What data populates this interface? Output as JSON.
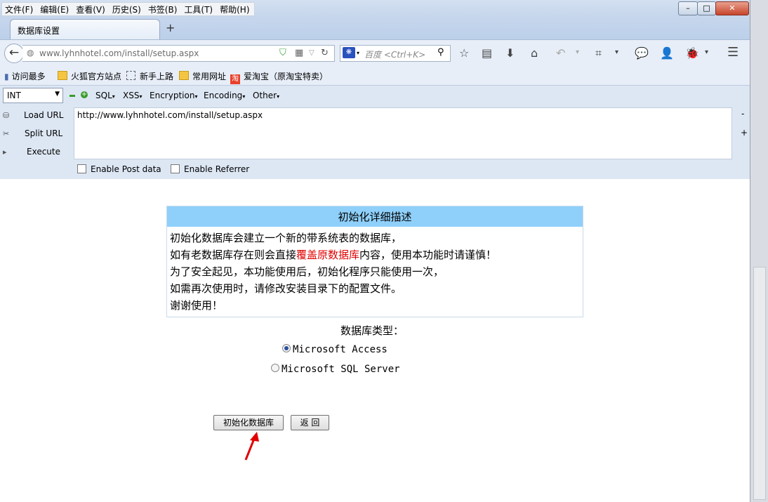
{
  "menubar": {
    "items": [
      "文件(F)",
      "编辑(E)",
      "查看(V)",
      "历史(S)",
      "书签(B)",
      "工具(T)",
      "帮助(H)"
    ]
  },
  "window_controls": {
    "min": "–",
    "max": "□",
    "close": "✕"
  },
  "tab": {
    "title": "数据库设置",
    "new_tab": "+"
  },
  "navbar": {
    "back": "←",
    "url_host": "www.lyhnhotel.com",
    "url_path": "/install/setup.aspx",
    "search_placeholder": "百度 <Ctrl+K>",
    "search_engine_icon": "baidu-paw-icon"
  },
  "bookmarks": [
    {
      "label": "访问最多",
      "icon": "bookmark-icon"
    },
    {
      "label": "火狐官方站点",
      "icon": "folder-icon"
    },
    {
      "label": "新手上路",
      "icon": "dashed-icon"
    },
    {
      "label": "常用网址",
      "icon": "folder-icon"
    },
    {
      "label": "爱淘宝（原淘宝特卖）",
      "icon": "taobao-icon"
    }
  ],
  "hackbar": {
    "select_value": "INT",
    "menus": [
      "SQL",
      "XSS",
      "Encryption",
      "Encoding",
      "Other"
    ],
    "load_url": "Load URL",
    "split_url": "Split URL",
    "execute": "Execute",
    "url_value": "http://www.lyhnhotel.com/install/setup.aspx",
    "enable_post": "Enable Post data",
    "enable_referrer": "Enable Referrer",
    "side_minus": "-",
    "side_plus": "+"
  },
  "content": {
    "desc_title": "初始化详细描述",
    "line1": "初始化数据库会建立一个新的带系统表的数据库，",
    "line2_pre": "如有老数据库存在则会直接",
    "line2_red": "覆盖原数据库",
    "line2_post": "内容，使用本功能时请谨慎！",
    "line3": "为了安全起见，本功能使用后，初始化程序只能使用一次，",
    "line4": "如需再次使用时，请修改安装目录下的配置文件。",
    "line5": "谢谢使用！",
    "db_type_label": "数据库类型：",
    "option_access": "Microsoft Access",
    "option_sqlserver": "Microsoft SQL Server",
    "selected": "Microsoft Access",
    "init_button": "初始化数据库",
    "back_button": "返 回"
  },
  "colors": {
    "desc_header": "#8fd0fb",
    "warning_red": "#e00000",
    "annotation_arrow": "#e00000"
  }
}
